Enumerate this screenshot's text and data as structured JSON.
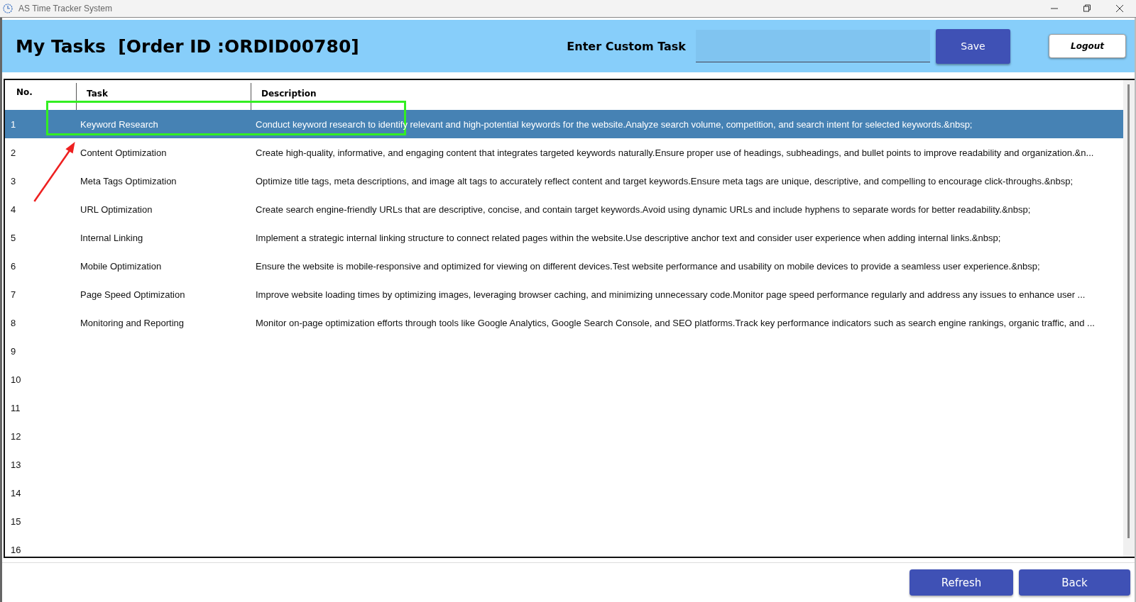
{
  "window": {
    "title": "AS Time Tracker System"
  },
  "header": {
    "title": "My Tasks  [Order ID :ORDID00780]",
    "custom_task_label": "Enter Custom Task",
    "save_button": "Save",
    "logout_button": "Logout"
  },
  "table": {
    "columns": [
      "No.",
      "Task",
      "Description"
    ],
    "rows": [
      {
        "no": "1",
        "task": "Keyword Research",
        "description": "Conduct keyword research to identify relevant and high-potential keywords for the website.Analyze search volume, competition, and search intent for selected keywords.&nbsp;",
        "selected": true
      },
      {
        "no": "2",
        "task": "Content Optimization",
        "description": "Create high-quality, informative, and engaging content that integrates targeted keywords naturally.Ensure proper use of headings, subheadings, and bullet points to improve readability and organization.&n...",
        "selected": false
      },
      {
        "no": "3",
        "task": "Meta Tags Optimization",
        "description": "Optimize title tags, meta descriptions, and image alt tags to accurately reflect content and target keywords.Ensure meta tags are unique, descriptive, and compelling to encourage click-throughs.&nbsp;",
        "selected": false
      },
      {
        "no": "4",
        "task": "URL Optimization",
        "description": "Create search engine-friendly URLs that are descriptive, concise, and contain target keywords.Avoid using dynamic URLs and include hyphens to separate words for better readability.&nbsp;",
        "selected": false
      },
      {
        "no": "5",
        "task": "Internal Linking",
        "description": "Implement a strategic internal linking structure to connect related pages within the website.Use descriptive anchor text and consider user experience when adding internal links.&nbsp;",
        "selected": false
      },
      {
        "no": "6",
        "task": "Mobile Optimization",
        "description": "Ensure the website is mobile-responsive and optimized for viewing on different devices.Test website performance and usability on mobile devices to provide a seamless user experience.&nbsp;",
        "selected": false
      },
      {
        "no": "7",
        "task": "Page Speed Optimization",
        "description": "Improve website loading times by optimizing images, leveraging browser caching, and minimizing unnecessary code.Monitor page speed performance regularly and address any issues to enhance user ...",
        "selected": false
      },
      {
        "no": "8",
        "task": "Monitoring and Reporting",
        "description": "Monitor on-page optimization efforts through tools like Google Analytics, Google Search Console, and SEO platforms.Track key performance indicators such as search engine rankings, organic traffic, and ...",
        "selected": false
      },
      {
        "no": "9",
        "selected": false
      },
      {
        "no": "10",
        "selected": false
      },
      {
        "no": "11",
        "selected": false
      },
      {
        "no": "12",
        "selected": false
      },
      {
        "no": "13",
        "selected": false
      },
      {
        "no": "14",
        "selected": false
      },
      {
        "no": "15",
        "selected": false
      },
      {
        "no": "16",
        "selected": false
      }
    ]
  },
  "footer": {
    "buttons": [
      "Refresh",
      "Back"
    ]
  },
  "annotations": [
    {
      "kind": "box",
      "color": "#33ee22"
    },
    {
      "kind": "arrow",
      "color": "#ee2020"
    }
  ]
}
